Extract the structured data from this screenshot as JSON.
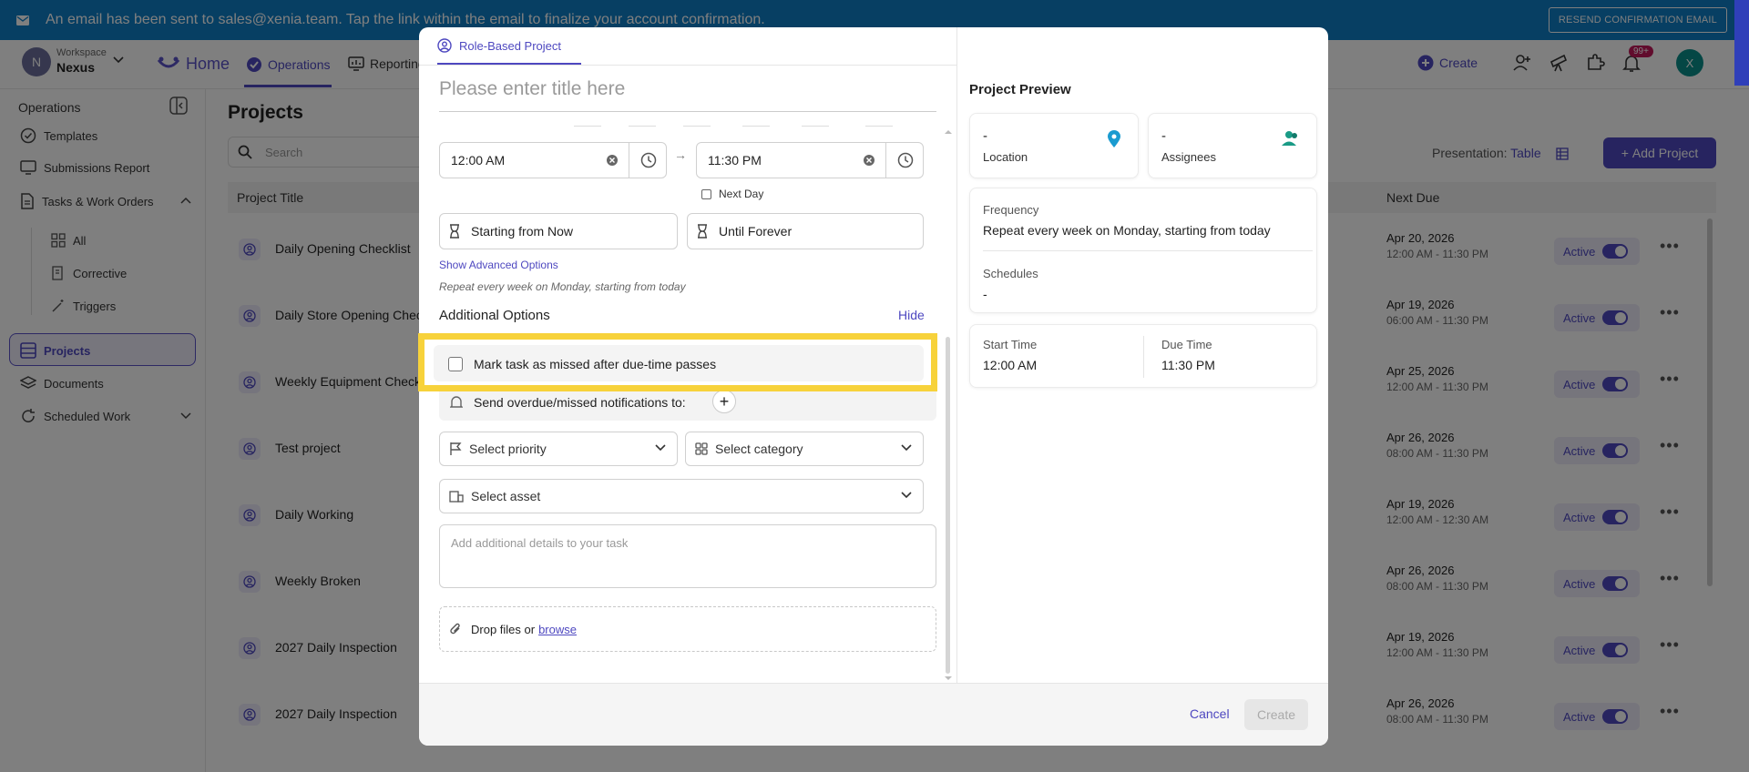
{
  "banner": {
    "message": "An email has been sent to sales@xenia.team. Tap the link within the email to finalize your account confirmation.",
    "resend_label": "RESEND CONFIRMATION EMAIL"
  },
  "topnav": {
    "workspace_initial": "N",
    "workspace_label": "Workspace",
    "workspace_name": "Nexus",
    "home": "Home",
    "operations": "Operations",
    "reporting": "Reporting",
    "create": "Create",
    "notif_badge": "99+",
    "user_initial": "X"
  },
  "sidebar": {
    "heading": "Operations",
    "items": {
      "templates": "Templates",
      "submissions": "Submissions Report",
      "tasks": "Tasks & Work Orders",
      "all": "All",
      "corrective": "Corrective",
      "triggers": "Triggers",
      "projects": "Projects",
      "documents": "Documents",
      "scheduled": "Scheduled Work"
    }
  },
  "main": {
    "title": "Projects",
    "search_placeholder": "Search",
    "presentation_label": "Presentation:",
    "presentation_value": "Table",
    "add_project": "Add Project",
    "col_title": "Project Title",
    "col_next_due": "Next Due",
    "rows": [
      {
        "title": "Daily Opening Checklist",
        "date": "Apr 20, 2026",
        "time": "12:00 AM - 11:30 PM",
        "status": "Active"
      },
      {
        "title": "Daily Store Opening Check",
        "date": "Apr 19, 2026",
        "time": "06:00 AM - 11:30 PM",
        "status": "Active"
      },
      {
        "title": "Weekly Equipment Check",
        "date": "Apr 25, 2026",
        "time": "12:00 AM - 11:30 PM",
        "status": "Active"
      },
      {
        "title": "Test project",
        "date": "Apr 26, 2026",
        "time": "08:00 AM - 11:30 PM",
        "status": "Active"
      },
      {
        "title": "Daily Working",
        "date": "Apr 19, 2026",
        "time": "12:00 AM - 12:30 AM",
        "status": "Active"
      },
      {
        "title": "Weekly Broken",
        "date": "Apr 26, 2026",
        "time": "08:00 AM - 11:30 PM",
        "status": "Active"
      },
      {
        "title": "2027 Daily Inspection",
        "date": "Apr 19, 2026",
        "time": "12:00 AM - 11:30 PM",
        "status": "Active"
      },
      {
        "title": "2027 Daily Inspection",
        "date": "Apr 26, 2026",
        "time": "08:00 AM - 11:30 PM",
        "status": "Active"
      }
    ]
  },
  "modal": {
    "tab": "Role-Based Project",
    "title_placeholder": "Please enter title here",
    "start_time": "12:00 AM",
    "end_time": "11:30 PM",
    "next_day": "Next Day",
    "starting": "Starting from Now",
    "until": "Until Forever",
    "show_advanced": "Show Advanced Options",
    "repeat_text": "Repeat every week on Monday, starting from today",
    "additional": "Additional Options",
    "hide": "Hide",
    "mark_missed": "Mark task as missed after due-time passes",
    "send_notif": "Send overdue/missed notifications to:",
    "priority": "Select priority",
    "category": "Select category",
    "asset": "Select asset",
    "details_placeholder": "Add additional details to your task",
    "drop_files": "Drop files or",
    "browse": "browse",
    "cancel": "Cancel",
    "create": "Create"
  },
  "preview": {
    "title": "Project Preview",
    "location_value": "-",
    "location_label": "Location",
    "assignees_value": "-",
    "assignees_label": "Assignees",
    "frequency_label": "Frequency",
    "frequency_value": "Repeat every week on Monday, starting from today",
    "schedules_label": "Schedules",
    "schedules_value": "-",
    "start_label": "Start Time",
    "start_value": "12:00 AM",
    "due_label": "Due Time",
    "due_value": "11:30 PM"
  },
  "colors": {
    "accent": "#4e48c0",
    "banner": "#0e7ec6",
    "highlight": "#f7d23b"
  }
}
